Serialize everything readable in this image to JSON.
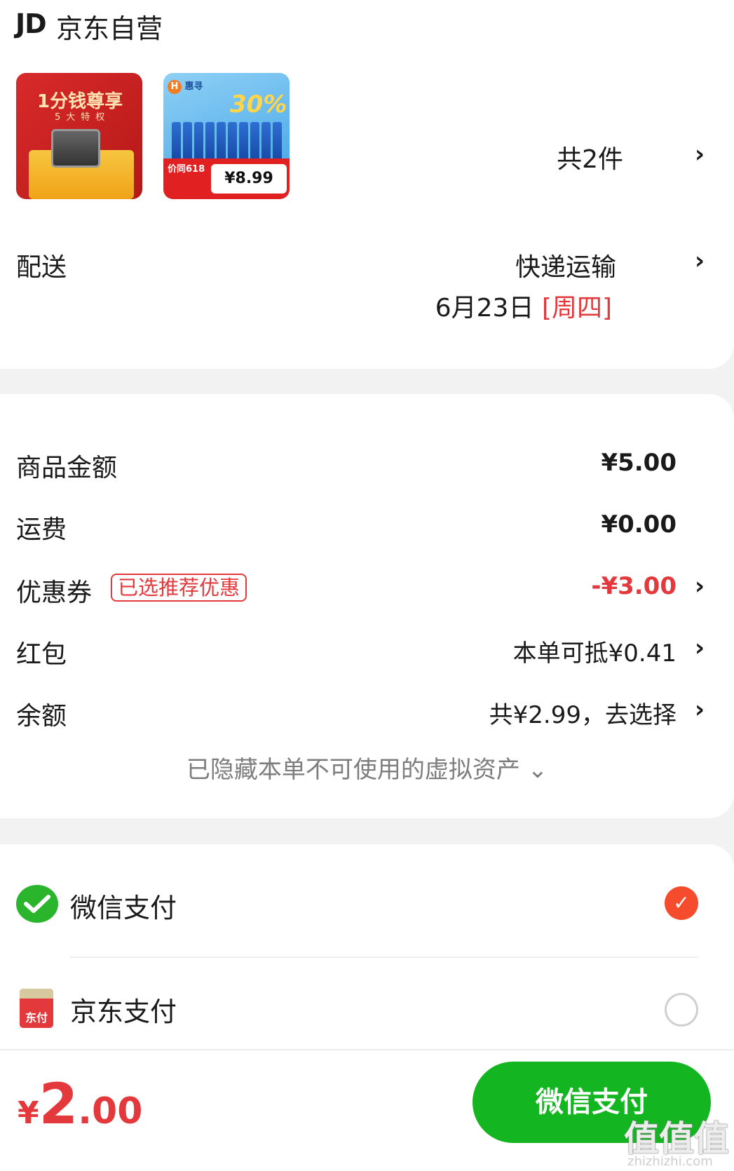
{
  "store": {
    "logo": "JD",
    "name": "京东自营"
  },
  "products": {
    "thumb1": {
      "title": "1分钱尊享",
      "subtitle": "5大特权"
    },
    "thumb2": {
      "brand": "惠寻",
      "promo": "30%",
      "price": "¥8.99",
      "promo_label": "价同618"
    },
    "count": "共2件"
  },
  "delivery": {
    "label": "配送",
    "method": "快递运输",
    "date": "6月23日 ",
    "weekday": "[周四]"
  },
  "summary": {
    "goods_label": "商品金额",
    "goods_value": "¥5.00",
    "shipping_label": "运费",
    "shipping_value": "¥0.00",
    "coupon_label": "优惠券",
    "coupon_tag": "已选推荐优惠",
    "coupon_value": "-¥3.00",
    "redpacket_label": "红包",
    "redpacket_value": "本单可抵¥0.41",
    "balance_label": "余额",
    "balance_value": "共¥2.99，去选择",
    "hidden_note": "已隐藏本单不可使用的虚拟资产 ⌄"
  },
  "payment": {
    "wechat_label": "微信支付",
    "jd_label": "京东支付",
    "jd_icon_text": "东付",
    "selected": "wechat"
  },
  "bottom": {
    "currency": "¥",
    "amount_int": "2",
    "amount_dec": ".00",
    "pay_button": "微信支付",
    "watermark": "值值值",
    "watermark_site": "zhizhizhi.com"
  },
  "colors": {
    "accent_red": "#e4393c",
    "wechat_green": "#13b520"
  }
}
